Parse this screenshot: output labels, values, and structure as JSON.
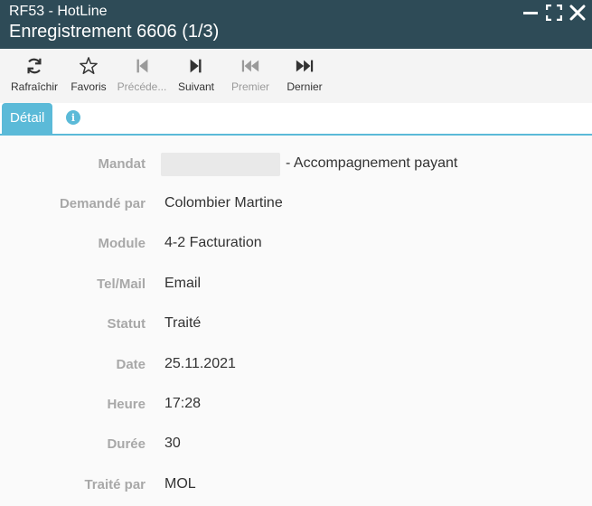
{
  "window": {
    "app_title": "RF53 - HotLine",
    "record_title": "Enregistrement 6606 (1/3)",
    "controls": [
      "minimize-icon",
      "maximize-icon",
      "close-icon"
    ]
  },
  "toolbar": {
    "refresh": {
      "label": "Rafraîchir",
      "icon": "refresh-icon"
    },
    "favorites": {
      "label": "Favoris",
      "icon": "star-icon"
    },
    "previous": {
      "label": "Précéde...",
      "icon": "step-backward-icon",
      "disabled": true
    },
    "next": {
      "label": "Suivant",
      "icon": "step-forward-icon"
    },
    "first": {
      "label": "Premier",
      "icon": "fast-backward-icon",
      "disabled": true
    },
    "last": {
      "label": "Dernier",
      "icon": "fast-forward-icon"
    }
  },
  "tabs": {
    "detail": "Détail",
    "info_icon": "info-icon",
    "accent": "#5bbad8"
  },
  "fields": {
    "mandat": {
      "label": "Mandat",
      "value": "- Accompagnement payant"
    },
    "demande_par": {
      "label": "Demandé par",
      "value": "Colombier Martine"
    },
    "module": {
      "label": "Module",
      "value": "4-2 Facturation"
    },
    "tel_mail": {
      "label": "Tel/Mail",
      "value": "Email"
    },
    "statut": {
      "label": "Statut",
      "value": "Traité"
    },
    "date": {
      "label": "Date",
      "value": "25.11.2021"
    },
    "heure": {
      "label": "Heure",
      "value": "17:28"
    },
    "duree": {
      "label": "Durée",
      "value": "30"
    },
    "traite_par": {
      "label": "Traité par",
      "value": "MOL"
    }
  },
  "colors": {
    "titlebar": "#2e4b57",
    "toolbar": "#f4f4f4",
    "label": "#a8a8a8",
    "value": "#333333"
  }
}
